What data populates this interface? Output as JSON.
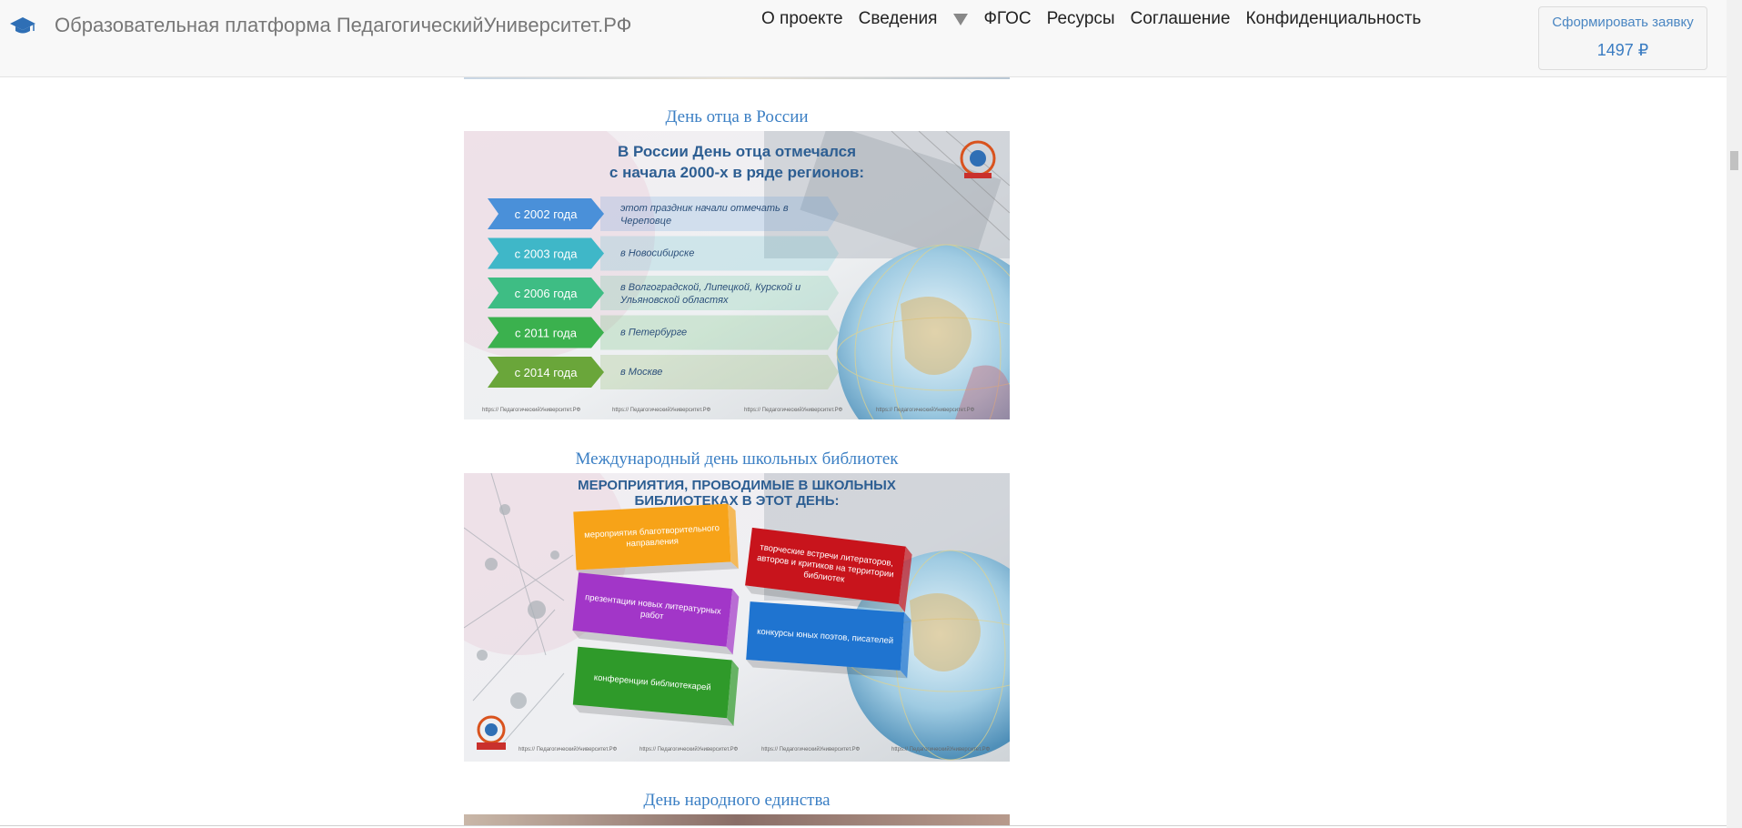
{
  "header": {
    "brand": "Образовательная платформа ПедагогическийУниверситет.РФ",
    "nav": [
      {
        "label": "О проекте"
      },
      {
        "label": "Сведения"
      },
      {
        "label": "ФГОС"
      },
      {
        "label": "Ресурсы"
      },
      {
        "label": "Соглашение"
      },
      {
        "label": "Конфиденциальность"
      }
    ],
    "order_button": "Сформировать заявку",
    "price": "1497 ₽"
  },
  "sections": [
    {
      "title": "День отца в России"
    },
    {
      "title": "Международный день школьных библиотек"
    },
    {
      "title": "День народного единства"
    }
  ],
  "slide1": {
    "heading_line1": "В России День отца отмечался",
    "heading_line2": "с начала 2000-х в ряде регионов:",
    "rows": [
      {
        "year": "с 2002 года",
        "text1": "этот праздник начали отмечать в",
        "text2": "Череповце"
      },
      {
        "year": "с 2003 года",
        "text1": "в Новосибирске",
        "text2": ""
      },
      {
        "year": "с 2006 года",
        "text1": "в Волгоградской, Липецкой, Курской и",
        "text2": "Ульяновской областях"
      },
      {
        "year": "с 2011 года",
        "text1": "в Петербурге",
        "text2": ""
      },
      {
        "year": "с 2014 года",
        "text1": "в Москве",
        "text2": ""
      }
    ],
    "watermark": "https:// ПедагогическийУниверситет.РФ"
  },
  "slide2": {
    "heading_line1": "МЕРОПРИЯТИЯ, ПРОВОДИМЫЕ В ШКОЛЬНЫХ",
    "heading_line2": "БИБЛИОТЕКАХ В ЭТОТ ДЕНЬ:",
    "boxes": [
      {
        "line1": "мероприятия благотворительного",
        "line2": "направления",
        "line3": ""
      },
      {
        "line1": "творческие встречи литераторов,",
        "line2": "авторов и критиков на территории",
        "line3": "библиотек"
      },
      {
        "line1": "презентации новых литературных",
        "line2": "работ",
        "line3": ""
      },
      {
        "line1": "конкурсы юных поэтов, писателей",
        "line2": "",
        "line3": ""
      },
      {
        "line1": "конференции библиотекарей",
        "line2": "",
        "line3": ""
      }
    ],
    "watermark": "https:// ПедагогическийУниверситет.РФ"
  },
  "colors": {
    "link": "#3b7fc4",
    "arrow_colors": [
      "#4a90d9",
      "#3fb7c8",
      "#3ebd84",
      "#3bb14e",
      "#6aa63a"
    ],
    "box_colors": [
      "#f7a318",
      "#c8141c",
      "#a236c8",
      "#1f74d0",
      "#2f9a2a"
    ]
  }
}
